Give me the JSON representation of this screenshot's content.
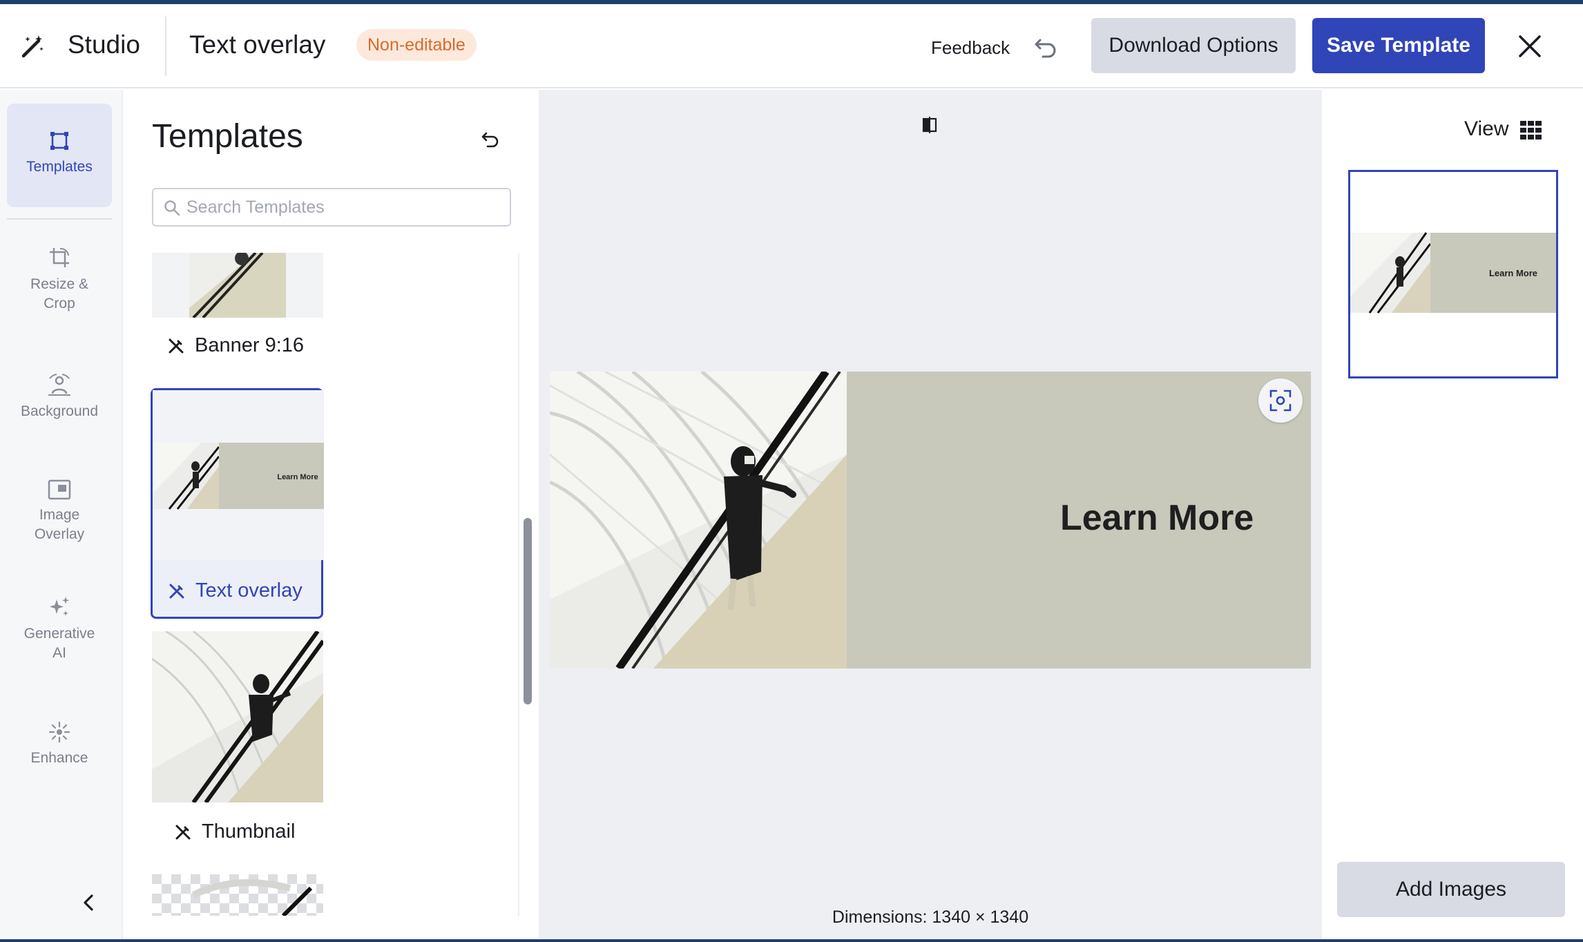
{
  "header": {
    "app_name": "Studio",
    "document_title": "Text overlay",
    "status_badge": "Non-editable",
    "feedback_label": "Feedback",
    "download_label": "Download Options",
    "save_label": "Save Template"
  },
  "leftnav": {
    "items": [
      {
        "label": "Templates",
        "icon": "templates-icon",
        "active": true
      },
      {
        "label": "Resize & Crop",
        "icon": "resize-crop-icon",
        "active": false
      },
      {
        "label": "Background",
        "icon": "background-icon",
        "active": false
      },
      {
        "label": "Image Overlay",
        "icon": "image-overlay-icon",
        "active": false
      },
      {
        "label": "Generative AI",
        "icon": "sparkle-icon",
        "active": false
      },
      {
        "label": "Enhance",
        "icon": "enhance-icon",
        "active": false
      }
    ]
  },
  "templates_panel": {
    "title": "Templates",
    "search_placeholder": "Search Templates",
    "templates": [
      {
        "name": "Banner 9:16",
        "selected": false,
        "thumb_text": ""
      },
      {
        "name": "Text overlay",
        "selected": true,
        "thumb_text": "Learn More"
      },
      {
        "name": "Thumbnail",
        "selected": false,
        "thumb_text": ""
      }
    ]
  },
  "canvas": {
    "overlay_text": "Learn More",
    "dimensions": "Dimensions: 1340 × 1340"
  },
  "right_panel": {
    "view_label": "View",
    "thumb_text": "Learn More",
    "add_images_label": "Add Images"
  },
  "colors": {
    "accent": "#2f45b8",
    "badge_bg": "#fde9dc",
    "badge_text": "#d9692a",
    "overlay_panel": "#c8c8bb"
  }
}
